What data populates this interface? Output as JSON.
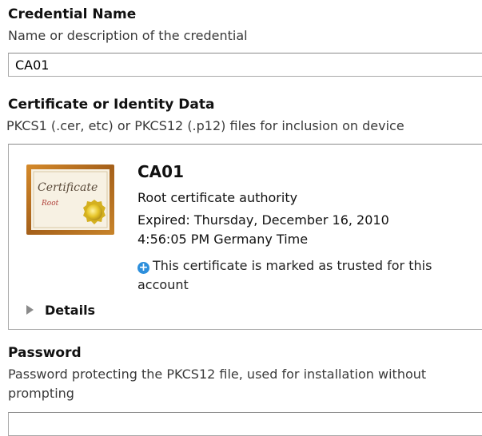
{
  "credential": {
    "title": "Credential Name",
    "description": "Name or description of the credential",
    "value": "CA01"
  },
  "certificate_section": {
    "title": "Certificate or Identity Data",
    "description": "PKCS1 (.cer, etc) or PKCS12 (.p12) files for inclusion on device"
  },
  "certificate": {
    "name": "CA01",
    "subtitle": "Root certificate authority",
    "expired_line1": "Expired: Thursday, December 16, 2010",
    "expired_line2": "4:56:05 PM Germany Time",
    "trusted_note": "This certificate is marked as trusted for this account",
    "details_label": "Details",
    "icon_text_top": "Certificate",
    "icon_text_bottom": "Root",
    "icon": "certificate-icon",
    "trusted_icon": "plus-circle-icon"
  },
  "password": {
    "title": "Password",
    "description": "Password protecting the PKCS12 file, used for installation without prompting",
    "value": ""
  },
  "colors": {
    "accent_blue": "#2d8fdc",
    "certificate_frame": "#b7701c",
    "seal_gold": "#e6c528"
  }
}
